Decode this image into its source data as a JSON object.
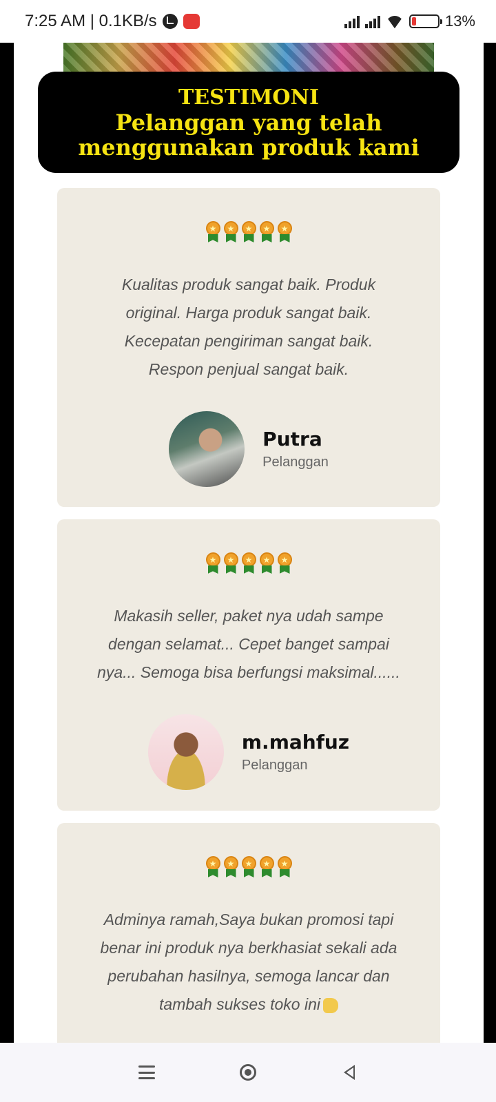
{
  "status_bar": {
    "time_speed": "7:25 AM | 0.1KB/s",
    "battery": "13%"
  },
  "header": {
    "line1": "TESTIMONI",
    "line2": "Pelanggan yang telah",
    "line3": "menggunakan produk kami",
    "text_color": "#f6e312",
    "bg_color": "#000000"
  },
  "testimonials": [
    {
      "rating_icon": "medal-stars-icon",
      "quote_lines": [
        "Kualitas produk sangat baik. Produk",
        "original. Harga produk sangat baik.",
        "Kecepatan pengiriman sangat baik.",
        "Respon penjual sangat baik."
      ],
      "name": "Putra",
      "role": "Pelanggan"
    },
    {
      "rating_icon": "medal-stars-icon",
      "quote_lines": [
        "Makasih seller, paket nya udah sampe",
        "dengan selamat... Cepet banget sampai",
        "nya... Semoga bisa berfungsi maksimal......"
      ],
      "name": "m.mahfuz",
      "role": "Pelanggan"
    },
    {
      "rating_icon": "medal-stars-icon",
      "quote_lines": [
        "Adminya ramah,Saya bukan promosi tapi",
        "benar ini produk nya berkhasiat sekali ada",
        "perubahan hasilnya, semoga lancar dan",
        "tambah sukses toko ini"
      ],
      "trailing_emoji": "thumbs-up-icon"
    }
  ],
  "colors": {
    "card_bg": "#efebe2",
    "frame": "#000000"
  }
}
